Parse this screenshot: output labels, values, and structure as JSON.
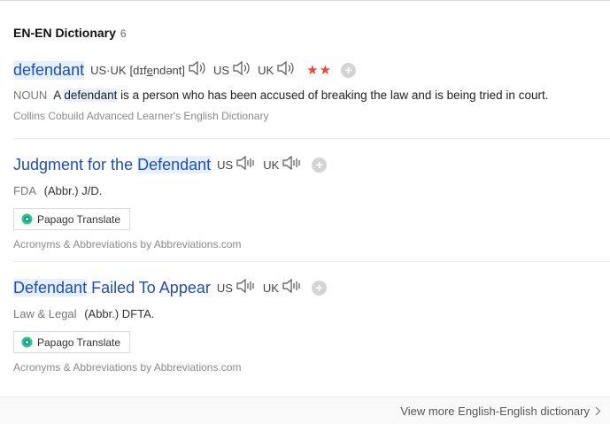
{
  "header": {
    "title": "EN-EN Dictionary",
    "count": "6"
  },
  "entries": [
    {
      "word_parts": [
        "",
        "defendant",
        ""
      ],
      "pron_label_all": "US·UK",
      "phonetic_pre": "[dɪf",
      "phonetic_u": "e",
      "phonetic_post": "ndənt]",
      "us_label": "US",
      "uk_label": "UK",
      "stars": "★★",
      "pos": "NOUN",
      "def_pre": "A",
      "def_hl": "defendant",
      "def_post": "is a person who has been accused of breaking the law and is being tried in court.",
      "source": "Collins Cobuild Advanced Learner's English Dictionary"
    },
    {
      "title_pre": "Judgment for the ",
      "title_hl": "Defendant",
      "us_label": "US",
      "uk_label": "UK",
      "category": "FDA",
      "abbr": "(Abbr.) J/D.",
      "papago": "Papago Translate",
      "source": "Acronyms & Abbreviations by Abbreviations.com"
    },
    {
      "title_hl": "Defendant",
      "title_post": " Failed To Appear",
      "us_label": "US",
      "uk_label": "UK",
      "category": "Law & Legal",
      "abbr": "(Abbr.) DFTA.",
      "papago": "Papago Translate",
      "source": "Acronyms & Abbreviations by Abbreviations.com"
    }
  ],
  "footer": {
    "more": "View more English-English dictionary"
  },
  "colors": {
    "link": "#1e4dbd",
    "highlight": "#e6f0fd",
    "star": "#e8473f"
  },
  "icons": [
    "speaker-icon",
    "add-icon",
    "papago-icon",
    "chevron-right-icon"
  ]
}
